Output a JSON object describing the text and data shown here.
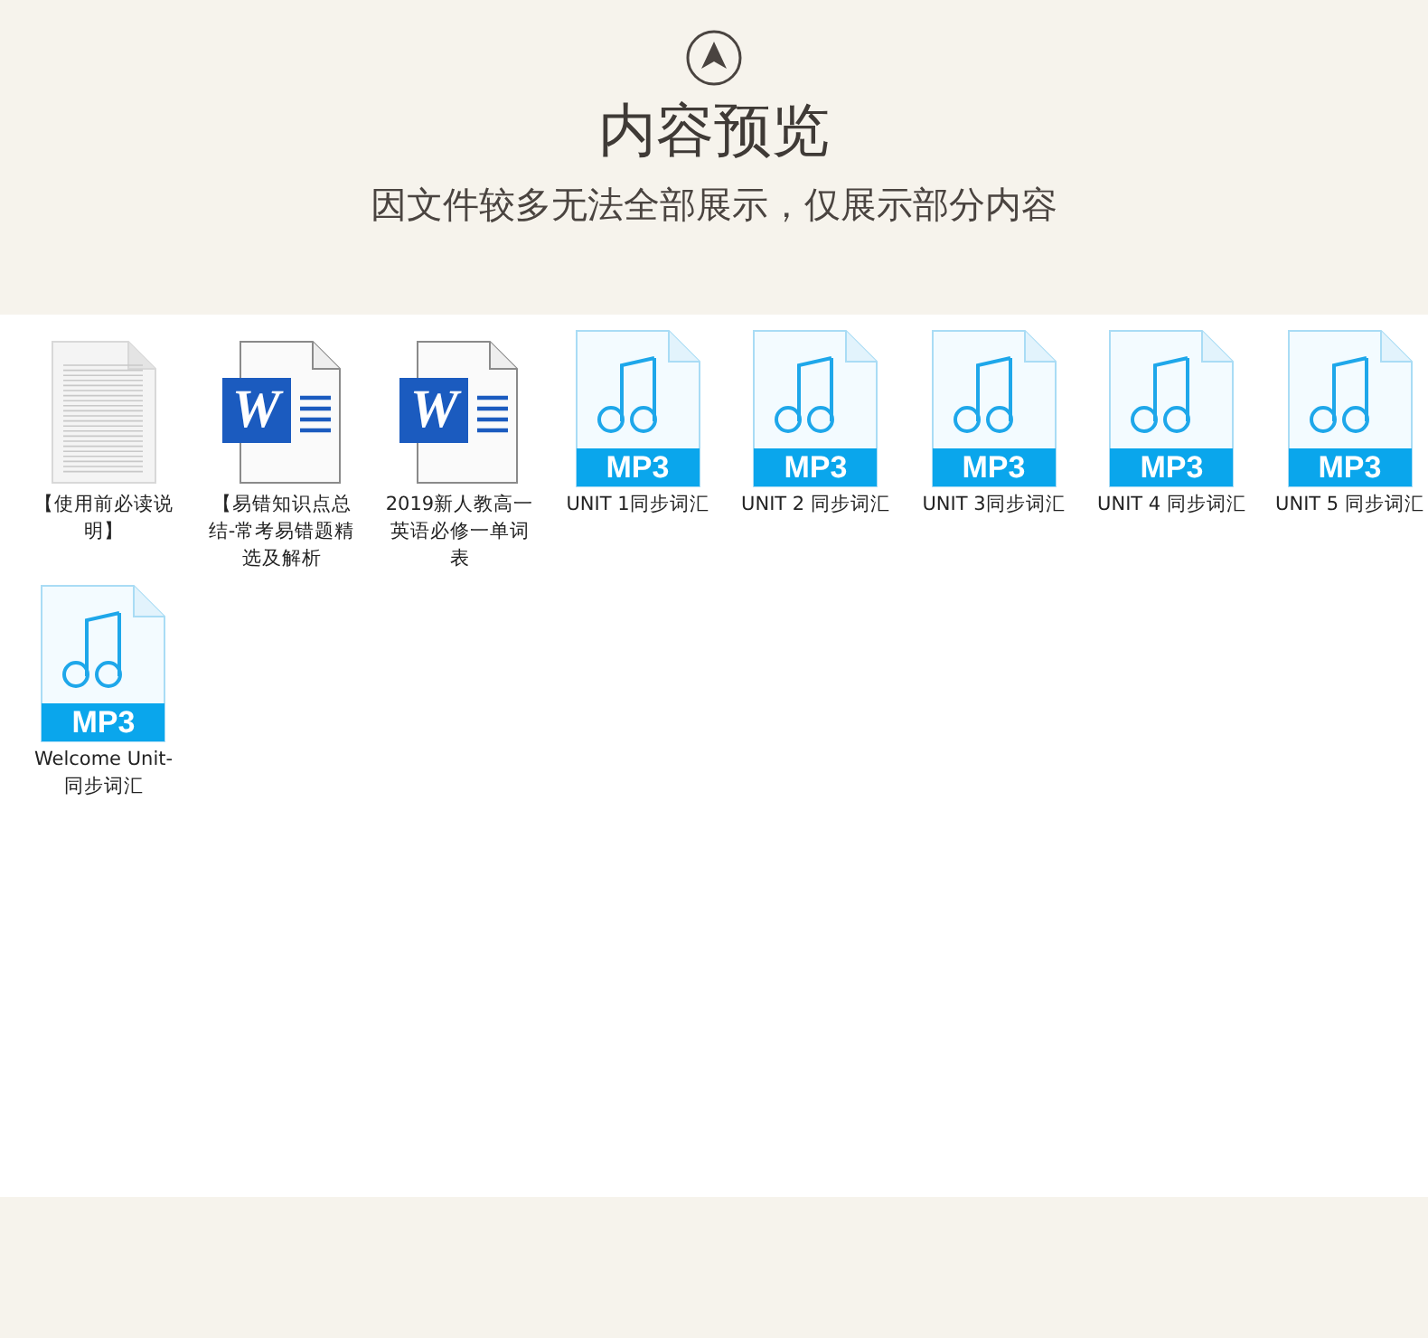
{
  "header": {
    "title": "内容预览",
    "subtitle": "因文件较多无法全部展示，仅展示部分内容"
  },
  "files": [
    {
      "kind": "text",
      "name": "【使用前必读说明】"
    },
    {
      "kind": "word",
      "badge": "W",
      "name": "【易错知识点总结-常考易错题精选及解析"
    },
    {
      "kind": "word",
      "badge": "W",
      "name": "2019新人教高一英语必修一单词表"
    },
    {
      "kind": "mp3",
      "badge": "MP3",
      "name": "UNIT 1同步词汇"
    },
    {
      "kind": "mp3",
      "badge": "MP3",
      "name": "UNIT 2 同步词汇"
    },
    {
      "kind": "mp3",
      "badge": "MP3",
      "name": "UNIT 3同步词汇"
    },
    {
      "kind": "mp3",
      "badge": "MP3",
      "name": "UNIT 4 同步词汇"
    },
    {
      "kind": "mp3",
      "badge": "MP3",
      "name": "UNIT 5 同步词汇"
    },
    {
      "kind": "mp3",
      "badge": "MP3",
      "name": "Welcome Unit-同步词汇"
    }
  ]
}
